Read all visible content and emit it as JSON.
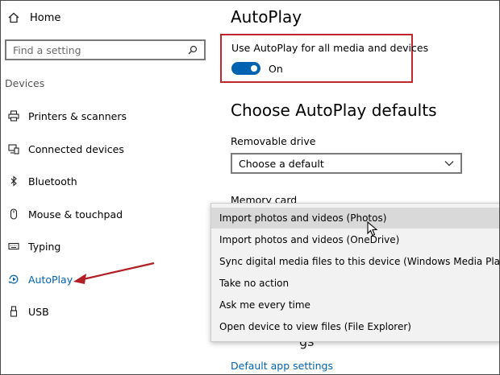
{
  "sidebar": {
    "home_label": "Home",
    "search_placeholder": "Find a setting",
    "section_label": "Devices",
    "items": [
      {
        "label": "Printers & scanners"
      },
      {
        "label": "Connected devices"
      },
      {
        "label": "Bluetooth"
      },
      {
        "label": "Mouse & touchpad"
      },
      {
        "label": "Typing"
      },
      {
        "label": "AutoPlay",
        "active": true
      },
      {
        "label": "USB"
      }
    ]
  },
  "main": {
    "title": "AutoPlay",
    "toggle_label": "Use AutoPlay for all media and devices",
    "toggle_state": "On",
    "defaults_title": "Choose AutoPlay defaults",
    "removable_label": "Removable drive",
    "removable_value": "Choose a default",
    "memory_label": "Memory card",
    "obscured_text": "gs",
    "link": "Default app settings"
  },
  "dropdown": {
    "options": [
      "Import photos and videos (Photos)",
      "Import photos and videos (OneDrive)",
      "Sync digital media files to this device (Windows Media Player)",
      "Take no action",
      "Ask me every time",
      "Open device to view files (File Explorer)"
    ],
    "hovered_index": 0
  },
  "colors": {
    "accent": "#0063b1",
    "highlight_border": "#c0272d",
    "arrow": "#b11f24"
  }
}
